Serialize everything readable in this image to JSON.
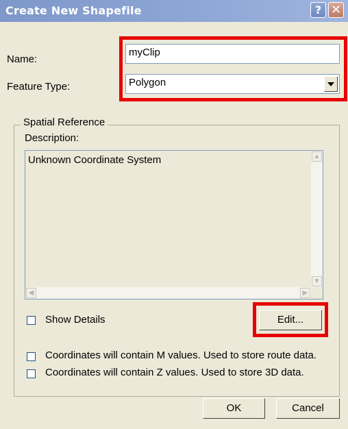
{
  "window": {
    "title": "Create New Shapefile"
  },
  "name": {
    "label": "Name:",
    "value": "myClip"
  },
  "feature_type": {
    "label": "Feature Type:",
    "selected": "Polygon"
  },
  "spatial_reference": {
    "legend": "Spatial Reference",
    "description_label": "Description:",
    "description_text": "Unknown Coordinate System",
    "show_details_label": "Show Details",
    "edit_label": "Edit..."
  },
  "options": {
    "m_values_label": "Coordinates will contain M values. Used to store route data.",
    "z_values_label": "Coordinates will contain Z values. Used to store 3D data."
  },
  "buttons": {
    "ok": "OK",
    "cancel": "Cancel"
  },
  "highlight_color": "#e60000"
}
